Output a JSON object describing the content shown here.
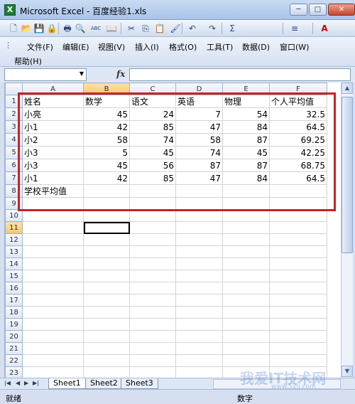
{
  "window": {
    "title": "Microsoft Excel - 百度经验1.xls",
    "min": "─",
    "max": "□",
    "close": "✕"
  },
  "toolbar": {
    "buttons": [
      {
        "icon": "new-icon",
        "glyph": "🗋"
      },
      {
        "icon": "open-icon",
        "glyph": "📂"
      },
      {
        "icon": "save-icon",
        "glyph": "💾"
      },
      {
        "icon": "permission-icon",
        "glyph": "🔒"
      },
      {
        "icon": "print-icon",
        "glyph": "🖶"
      },
      {
        "icon": "preview-icon",
        "glyph": "🔍"
      },
      {
        "icon": "spelling-icon",
        "glyph": "ABC"
      },
      {
        "icon": "research-icon",
        "glyph": "📖"
      },
      {
        "icon": "cut-icon",
        "glyph": "✂"
      },
      {
        "icon": "copy-icon",
        "glyph": "⎘"
      },
      {
        "icon": "paste-icon",
        "glyph": "📋"
      },
      {
        "icon": "format-painter-icon",
        "glyph": "🖌"
      },
      {
        "icon": "undo-icon",
        "glyph": "↶"
      },
      {
        "icon": "redo-icon",
        "glyph": "↷"
      },
      {
        "icon": "autosum-icon",
        "glyph": "Σ"
      },
      {
        "icon": "align-icon",
        "glyph": "≡"
      },
      {
        "icon": "font-color-icon",
        "glyph": "A"
      }
    ]
  },
  "menu": {
    "items": [
      "文件(F)",
      "编辑(E)",
      "视图(V)",
      "插入(I)",
      "格式(O)",
      "工具(T)",
      "数据(D)",
      "窗口(W)"
    ],
    "help": "帮助(H)"
  },
  "formula_bar": {
    "name_box": "",
    "fx": "fx",
    "content": ""
  },
  "sheet": {
    "columns": [
      "A",
      "B",
      "C",
      "D",
      "E",
      "F"
    ],
    "selected_row": "11",
    "rows": [
      {
        "n": "1",
        "cells": [
          "姓名",
          "数学",
          "语文",
          "英语",
          "物理",
          "个人平均值"
        ]
      },
      {
        "n": "2",
        "cells": [
          "小亮",
          "45",
          "24",
          "7",
          "54",
          "32.5"
        ]
      },
      {
        "n": "3",
        "cells": [
          "小1",
          "42",
          "85",
          "47",
          "84",
          "64.5"
        ]
      },
      {
        "n": "4",
        "cells": [
          "小2",
          "58",
          "74",
          "58",
          "87",
          "69.25"
        ]
      },
      {
        "n": "5",
        "cells": [
          "小3",
          "5",
          "45",
          "74",
          "45",
          "42.25"
        ]
      },
      {
        "n": "6",
        "cells": [
          "小3",
          "45",
          "56",
          "87",
          "87",
          "68.75"
        ]
      },
      {
        "n": "7",
        "cells": [
          "小1",
          "42",
          "85",
          "47",
          "84",
          "64.5"
        ]
      },
      {
        "n": "8",
        "cells": [
          "学校平均值",
          "",
          "",
          "",
          "",
          ""
        ]
      },
      {
        "n": "9",
        "cells": [
          "",
          "",
          "",
          "",
          "",
          ""
        ]
      },
      {
        "n": "10",
        "cells": [
          "",
          "",
          "",
          "",
          "",
          ""
        ]
      },
      {
        "n": "11",
        "cells": [
          "",
          "",
          "",
          "",
          "",
          ""
        ]
      },
      {
        "n": "12",
        "cells": [
          "",
          "",
          "",
          "",
          "",
          ""
        ]
      },
      {
        "n": "13",
        "cells": [
          "",
          "",
          "",
          "",
          "",
          ""
        ]
      },
      {
        "n": "14",
        "cells": [
          "",
          "",
          "",
          "",
          "",
          ""
        ]
      },
      {
        "n": "15",
        "cells": [
          "",
          "",
          "",
          "",
          "",
          ""
        ]
      },
      {
        "n": "16",
        "cells": [
          "",
          "",
          "",
          "",
          "",
          ""
        ]
      },
      {
        "n": "17",
        "cells": [
          "",
          "",
          "",
          "",
          "",
          ""
        ]
      },
      {
        "n": "18",
        "cells": [
          "",
          "",
          "",
          "",
          "",
          ""
        ]
      },
      {
        "n": "19",
        "cells": [
          "",
          "",
          "",
          "",
          "",
          ""
        ]
      },
      {
        "n": "20",
        "cells": [
          "",
          "",
          "",
          "",
          "",
          ""
        ]
      },
      {
        "n": "21",
        "cells": [
          "",
          "",
          "",
          "",
          "",
          ""
        ]
      },
      {
        "n": "22",
        "cells": [
          "",
          "",
          "",
          "",
          "",
          ""
        ]
      },
      {
        "n": "23",
        "cells": [
          "",
          "",
          "",
          "",
          "",
          ""
        ]
      }
    ]
  },
  "tabs": {
    "nav": [
      "|◀",
      "◀",
      "▶",
      "▶|"
    ],
    "sheets": [
      "Sheet1",
      "Sheet2",
      "Sheet3"
    ]
  },
  "status": {
    "left": "就绪",
    "right": "数字"
  },
  "watermark": {
    "text": "我爱IT技术网",
    "url": "www.52ij.com"
  },
  "colors": {
    "highlight_frame": "#cc2026",
    "selected_header": "#f5c66a"
  }
}
